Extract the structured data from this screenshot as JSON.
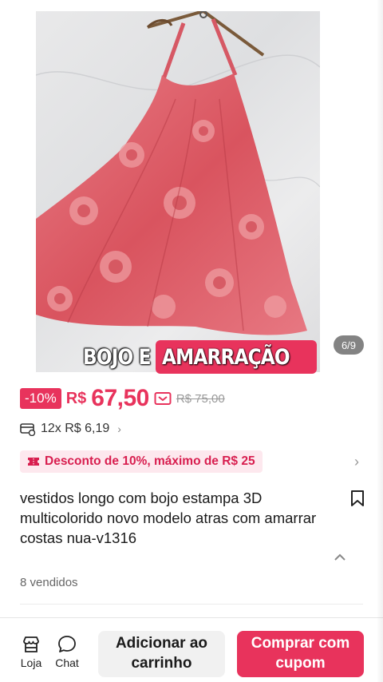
{
  "gallery": {
    "caption_part1": "BOJO E",
    "caption_part2": "AMARRAÇÃO",
    "counter": "6/9",
    "image_description_icon": "dress-photo"
  },
  "price": {
    "discount_badge": "-10%",
    "currency": "R$",
    "value": "67,50",
    "coupon_icon": "coupon-ticket-icon",
    "old_price": "R$ 75,00"
  },
  "installments": {
    "icon": "credit-card-icon",
    "text": "12x R$ 6,19",
    "chevron": "›"
  },
  "promo": {
    "icon": "ticket-icon",
    "text": "Desconto de 10%, máximo de R$ 25",
    "chevron": "›"
  },
  "product": {
    "title": "vestidos longo  com bojo estampa 3D multicolorido novo modelo atras com amarrar costas nua-v1316",
    "sold": "8 vendidos"
  },
  "bottom_bar": {
    "store_label": "Loja",
    "chat_label": "Chat",
    "cart_line1": "Adicionar ao",
    "cart_line2": "carrinho",
    "buy_line1": "Comprar com",
    "buy_line2": "cupom"
  },
  "colors": {
    "accent": "#e8335c",
    "promo_bg": "#fde8ee",
    "promo_text": "#d81e4f"
  }
}
